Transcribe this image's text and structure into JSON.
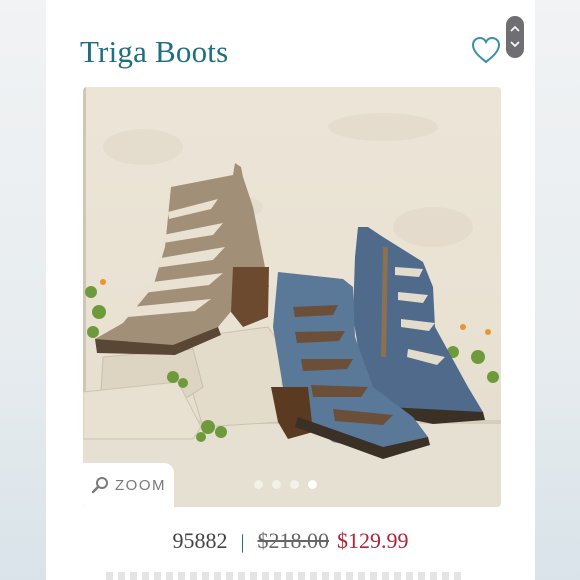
{
  "product": {
    "title": "Triga Boots",
    "sku": "95882",
    "separator": "|",
    "original_price": "$218.00",
    "sale_price": "$129.99"
  },
  "gallery": {
    "zoom_label": "ZOOM",
    "image_count": 4,
    "active_index": 3
  },
  "icons": {
    "favorite": "heart-outline-icon",
    "zoom": "magnifier-icon",
    "scroll_up": "chevron-up-icon",
    "scroll_down": "chevron-down-icon"
  },
  "colors": {
    "title": "#1e6f80",
    "sale_price": "#b1243a",
    "heart": "#3b8fae"
  }
}
